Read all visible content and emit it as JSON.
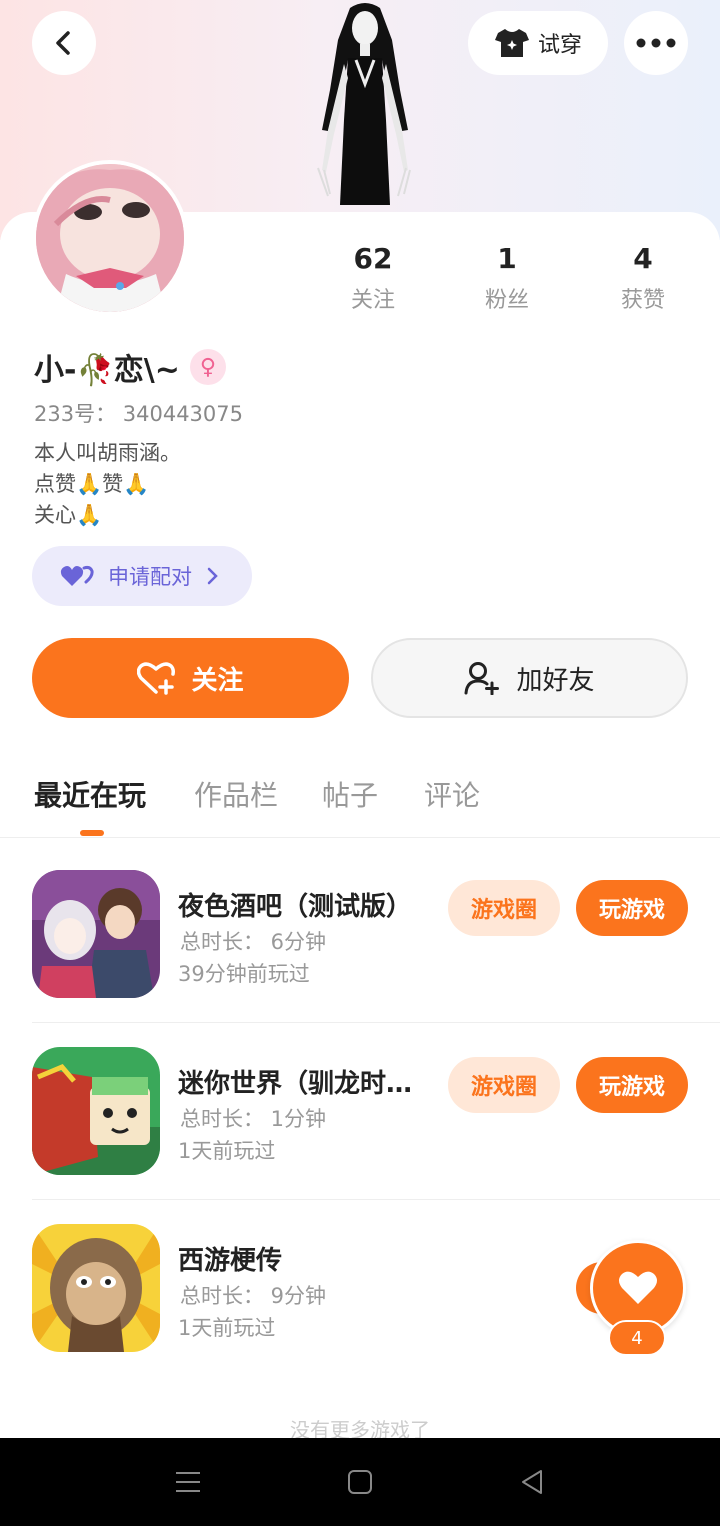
{
  "header": {
    "try_on_label": "试穿"
  },
  "profile": {
    "username": "小-🥀恋\\~",
    "gender_symbol": "♀",
    "id_line": "233号： 340443075",
    "bio": [
      "本人叫胡雨涵。",
      "点赞🙏赞🙏",
      "关心🙏"
    ],
    "pair_label": "申请配对",
    "stats": [
      {
        "value": "62",
        "label": "关注"
      },
      {
        "value": "1",
        "label": "粉丝"
      },
      {
        "value": "4",
        "label": "获赞"
      }
    ]
  },
  "actions": {
    "follow_label": "关注",
    "add_friend_label": "加好友"
  },
  "tabs": [
    {
      "label": "最近在玩",
      "active": true
    },
    {
      "label": "作品栏",
      "active": false
    },
    {
      "label": "帖子",
      "active": false
    },
    {
      "label": "评论",
      "active": false
    }
  ],
  "games": [
    {
      "title": "夜色酒吧（测试版）",
      "duration": "总时长： 6分钟",
      "last_played": "39分钟前玩过",
      "circle_label": "游戏圈",
      "play_label": "玩游戏"
    },
    {
      "title": "迷你世界（驯龙时…",
      "duration": "总时长： 1分钟",
      "last_played": "1天前玩过",
      "circle_label": "游戏圈",
      "play_label": "玩游戏"
    },
    {
      "title": "西游梗传",
      "duration": "总时长： 9分钟",
      "last_played": "1天前玩过"
    }
  ],
  "floating_like": {
    "count": "4"
  },
  "footer": {
    "no_more_text": "没有更多游戏了"
  },
  "colors": {
    "accent": "#fb741d",
    "pair_bg": "#ecebfb",
    "pair_text": "#6a64d8"
  }
}
